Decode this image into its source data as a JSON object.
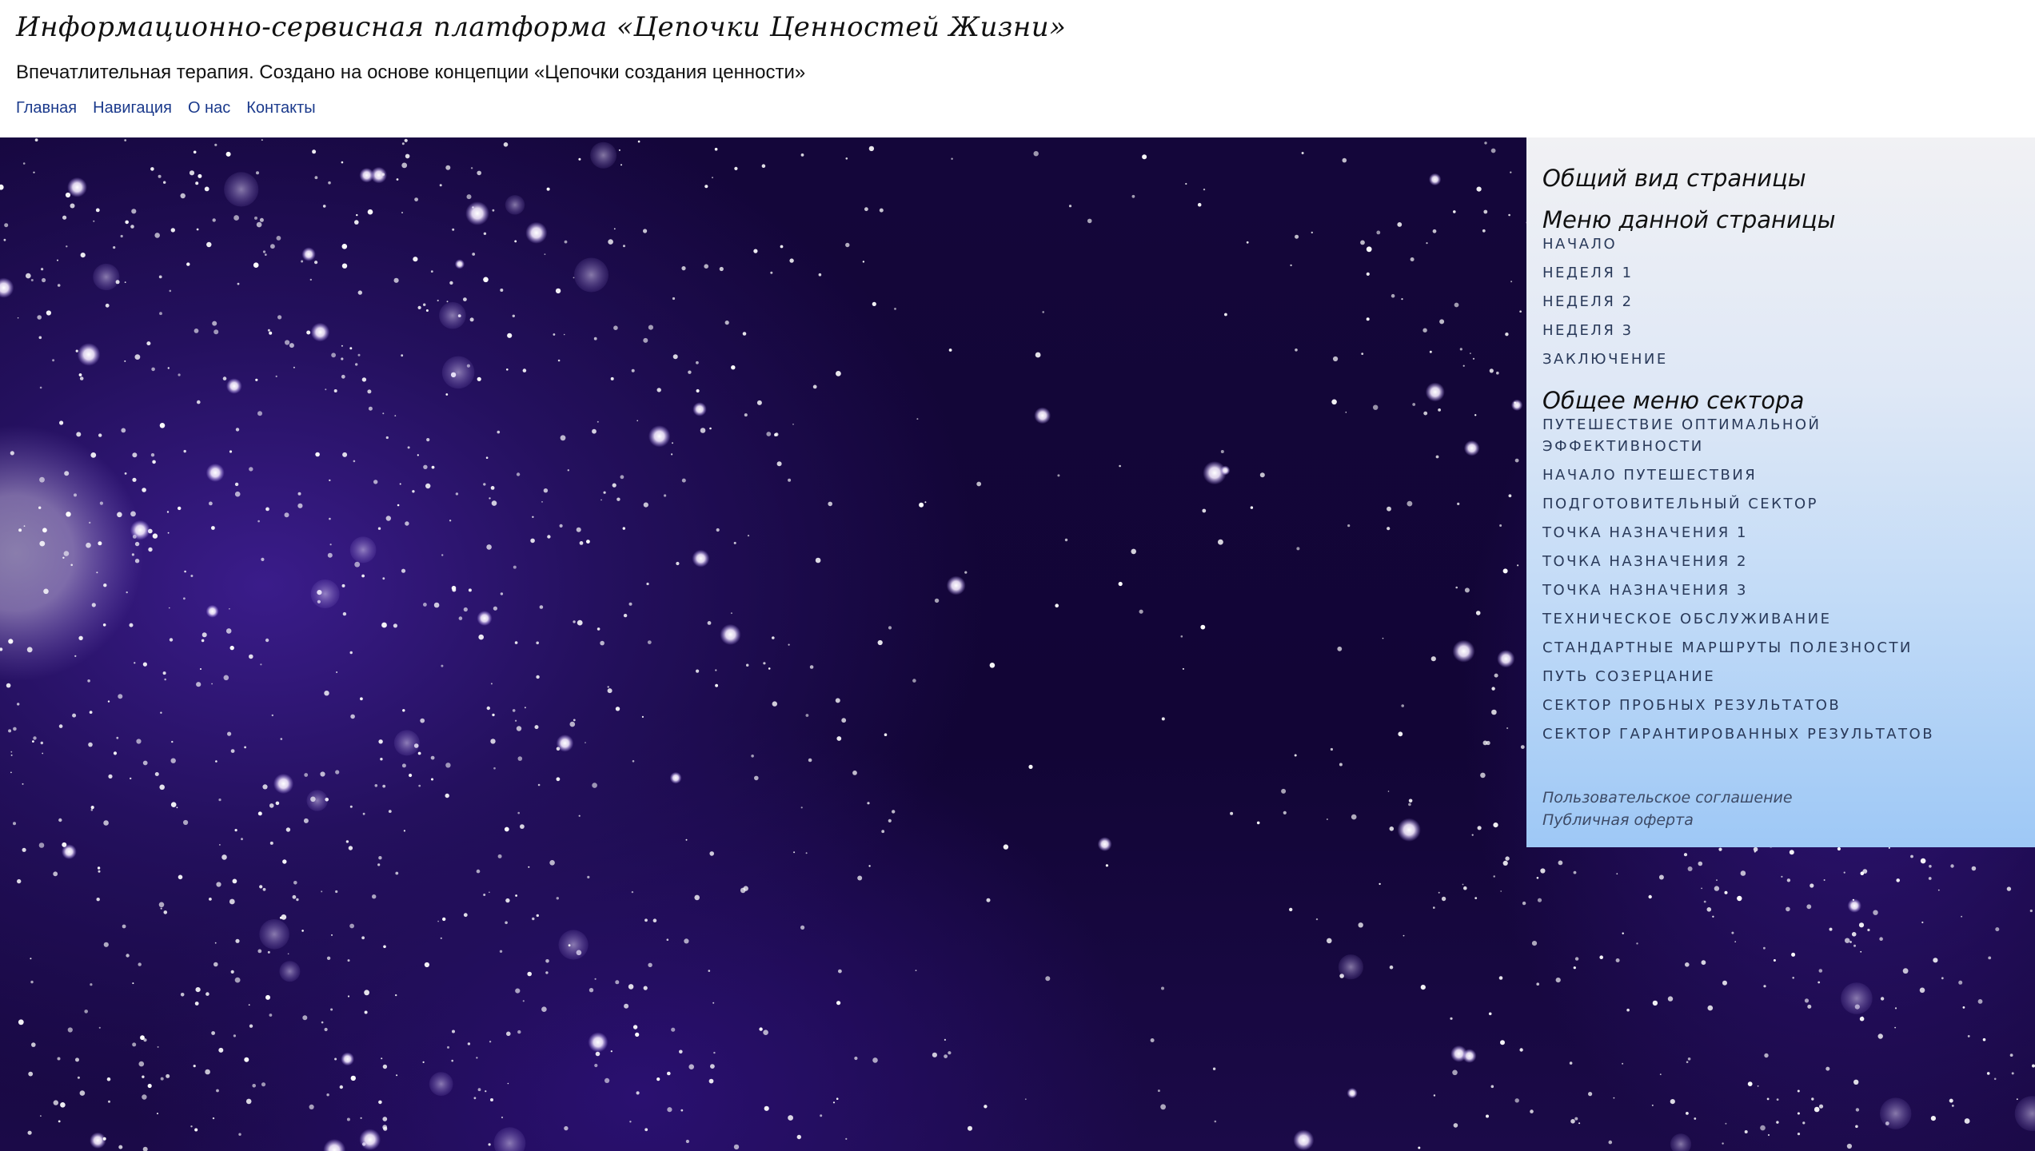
{
  "header": {
    "site_title": "Информационно-сервисная платформа «Цепочки Ценностей Жизни»",
    "subtitle": "Впечатлительная терапия. Создано на основе концепции «Цепочки создания ценности»",
    "nav": [
      "Главная",
      "Навигация",
      "О нас",
      "Контакты"
    ]
  },
  "sidebar": {
    "overview_heading": "Общий вид страницы",
    "page_menu_heading": "Меню данной страницы",
    "page_menu": [
      "Начало",
      "Неделя 1",
      "Неделя 2",
      "Неделя 3",
      "Заключение"
    ],
    "sector_menu_heading": "Общее меню сектора",
    "sector_menu": [
      "Путешествие оптимальной эффективности",
      "Начало путешествия",
      "Подготовительный сектор",
      "Точка назначения 1",
      "Точка назначения 2",
      "Точка назначения 3",
      "Техническое обслуживание",
      "Стандартные маршруты полезности",
      "Путь созерцание",
      "Сектор пробных результатов",
      "Сектор гарантированных результатов"
    ],
    "footer_links": [
      "Пользовательское соглашение",
      "Публичная оферта"
    ]
  },
  "colors": {
    "nav_link": "#1b3a8c",
    "hero_dark": "#14063a",
    "hero_purple": "#3a1c8a",
    "sidebar_top": "#f1f1f4",
    "sidebar_bottom": "#9ec8f6"
  }
}
